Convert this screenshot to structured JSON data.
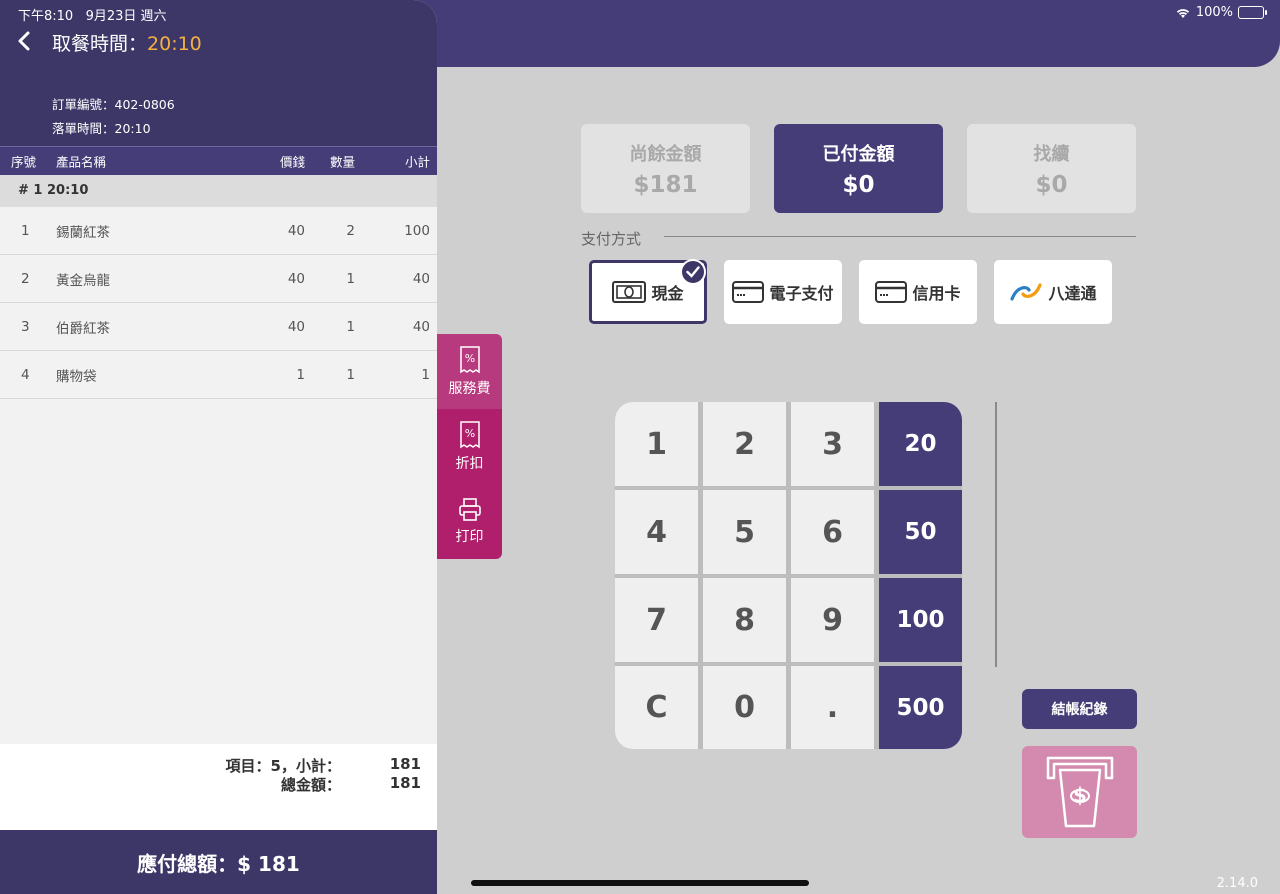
{
  "status_bar": {
    "time": "下午8:10",
    "date": "9月23日 週六",
    "battery": "100%"
  },
  "order": {
    "pickup_label": "取餐時間：",
    "pickup_time": "20:10",
    "order_no": "訂單編號：402-0806",
    "placed_time": "落單時間：20:10"
  },
  "table": {
    "headers": {
      "no": "序號",
      "name": "產品名稱",
      "price": "價錢",
      "qty": "數量",
      "subtotal": "小計"
    },
    "group": "# 1  20:10",
    "rows": [
      {
        "no": "1",
        "name": "錫蘭紅茶",
        "price": "40",
        "qty": "2",
        "subtotal": "100"
      },
      {
        "no": "2",
        "name": "黃金烏龍",
        "price": "40",
        "qty": "1",
        "subtotal": "40"
      },
      {
        "no": "3",
        "name": "伯爵紅茶",
        "price": "40",
        "qty": "1",
        "subtotal": "40"
      },
      {
        "no": "4",
        "name": "購物袋",
        "price": "1",
        "qty": "1",
        "subtotal": "1"
      }
    ]
  },
  "totals": {
    "items_label": "項目：5，小計：",
    "items_value": "181",
    "total_label": "總金額：",
    "total_value": "181",
    "due": "應付總額：$ 181"
  },
  "side_tabs": {
    "service": "服務費",
    "discount": "折扣",
    "print": "打印"
  },
  "summary": {
    "remaining_label": "尚餘金額",
    "remaining_value": "$181",
    "paid_label": "已付金額",
    "paid_value": "$0",
    "change_label": "找續",
    "change_value": "$0"
  },
  "payment": {
    "title": "支付方式",
    "methods": [
      {
        "label": "現金",
        "icon": "cash-icon",
        "selected": true
      },
      {
        "label": "電子支付",
        "icon": "card-icon",
        "selected": false
      },
      {
        "label": "信用卡",
        "icon": "card-icon",
        "selected": false
      },
      {
        "label": "八達通",
        "icon": "octopus-logo",
        "selected": false
      }
    ]
  },
  "keypad": {
    "keys": [
      "1",
      "2",
      "3",
      "4",
      "5",
      "6",
      "7",
      "8",
      "9",
      "C",
      "0",
      "."
    ],
    "quick": [
      "20",
      "50",
      "100",
      "500"
    ]
  },
  "records_button": "結帳紀錄",
  "version": "2.14.0",
  "colors": {
    "primary": "#453d77",
    "accent": "#b01f6c",
    "pickup_time": "#f5b041"
  }
}
